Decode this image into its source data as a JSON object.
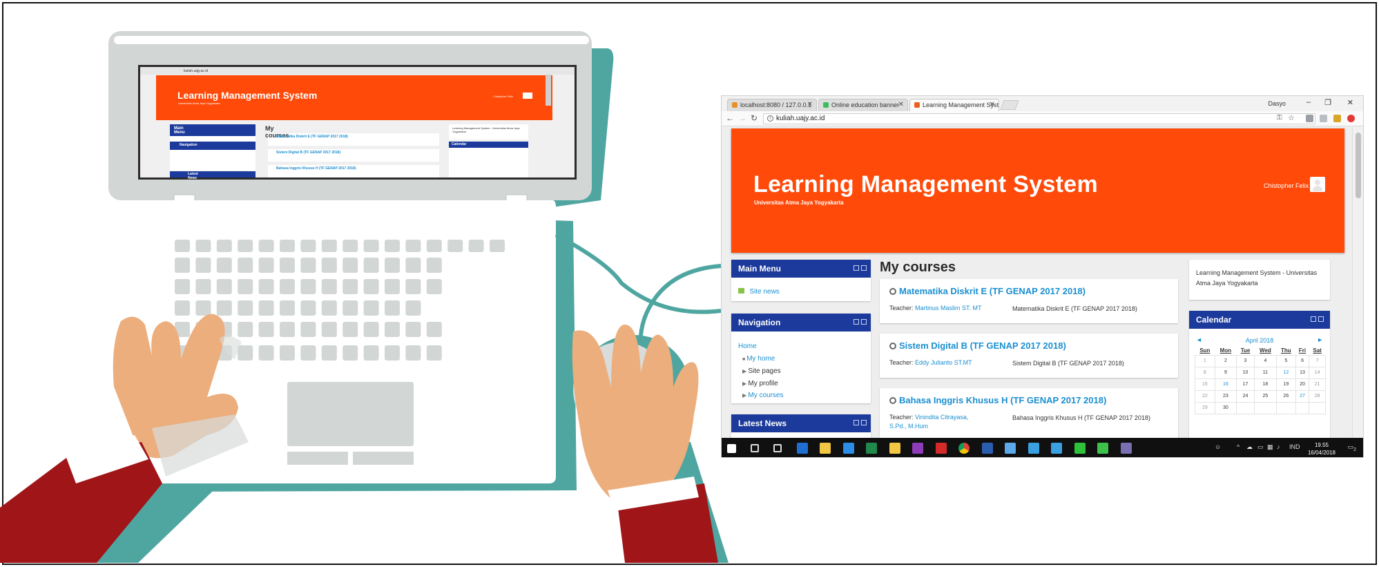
{
  "tabs": [
    {
      "label": "localhost:8080 / 127.0.0.1",
      "icon": "database-icon",
      "color": "#e8902a"
    },
    {
      "label": "Online education banner",
      "icon": "file-icon",
      "color": "#3cbd5b"
    },
    {
      "label": "Learning Management System",
      "icon": "moodle-icon",
      "color": "#e8611a"
    }
  ],
  "window": {
    "user": "Dasyo",
    "minimize": "–",
    "restore": "❐",
    "close": "✕"
  },
  "address": {
    "url": "kuliah.uajy.ac.id"
  },
  "banner": {
    "title": "Learning Management System",
    "subtitle": "Universitas Atma Jaya Yogyakarta",
    "user_name": "Chistopher Felix",
    "color": "#ff4a0a"
  },
  "main_menu": {
    "title": "Main Menu",
    "items": [
      {
        "label": "Site news"
      }
    ]
  },
  "navigation": {
    "title": "Navigation",
    "home": "Home",
    "items": [
      {
        "label": "My home",
        "link": true
      },
      {
        "label": "Site pages",
        "link": false
      },
      {
        "label": "My profile",
        "link": false
      },
      {
        "label": "My courses",
        "link": true
      }
    ]
  },
  "latest_news": {
    "title": "Latest News"
  },
  "my_courses": {
    "heading": "My courses",
    "courses": [
      {
        "title": "Matematika Diskrit E (TF GENAP 2017 2018)",
        "teacher_label": "Teacher:",
        "teacher": "Martinus Maslim ST. MT",
        "summary": "Matematika Diskrit E (TF GENAP 2017 2018)"
      },
      {
        "title": "Sistem Digital B (TF GENAP 2017 2018)",
        "teacher_label": "Teacher:",
        "teacher": "Eddy Julianto ST.MT",
        "summary": "Sistem Digital B (TF GENAP 2017 2018)"
      },
      {
        "title": "Bahasa Inggris Khusus H (TF GENAP 2017 2018)",
        "teacher_label": "Teacher:",
        "teacher": "Vinindita Citrayasa, S.Pd., M.Hum",
        "summary": "Bahasa Inggris Khusus H (TF GENAP 2017 2018)"
      }
    ]
  },
  "about": {
    "text": "Learning Management System - Universitas Atma Jaya Yogyakarta"
  },
  "calendar": {
    "title": "Calendar",
    "month": "April 2018",
    "prev": "◄",
    "next": "►",
    "days": [
      "Sun",
      "Mon",
      "Tue",
      "Wed",
      "Thu",
      "Fri",
      "Sat"
    ],
    "weeks": [
      [
        "1",
        "2",
        "3",
        "4",
        "5",
        "6",
        "7"
      ],
      [
        "8",
        "9",
        "10",
        "11",
        "12",
        "13",
        "14"
      ],
      [
        "15",
        "16",
        "17",
        "18",
        "19",
        "20",
        "21"
      ],
      [
        "22",
        "23",
        "24",
        "25",
        "26",
        "27",
        "28"
      ],
      [
        "29",
        "30",
        "",
        "",
        "",
        "",
        ""
      ]
    ],
    "linked_days": [
      "12",
      "16",
      "27"
    ]
  },
  "taskbar": {
    "lang": "IND",
    "time": "19.55",
    "date": "16/04/2018",
    "notifications": "2",
    "apps": [
      {
        "icon": "windows-start-icon",
        "color": "#ffffff"
      },
      {
        "icon": "search-icon",
        "color": "#dddddd"
      },
      {
        "icon": "task-view-icon",
        "color": "#dddddd"
      },
      {
        "icon": "outlook-icon",
        "color": "#1f6fd1"
      },
      {
        "icon": "file-explorer-icon",
        "color": "#f2c744"
      },
      {
        "icon": "edge-icon",
        "color": "#2d8ce6"
      },
      {
        "icon": "excel-icon",
        "color": "#1f8a4c"
      },
      {
        "icon": "store-icon",
        "color": "#f2c744"
      },
      {
        "icon": "onenote-icon",
        "color": "#8d3cb8"
      },
      {
        "icon": "acrobat-icon",
        "color": "#d42a2a"
      },
      {
        "icon": "chrome-icon",
        "color": "#e7b526"
      },
      {
        "icon": "word-icon",
        "color": "#2a5db0"
      },
      {
        "icon": "dropbox-icon",
        "color": "#5da8e8"
      },
      {
        "icon": "app-icon",
        "color": "#3aa0e0"
      },
      {
        "icon": "app-icon",
        "color": "#3aa0e0"
      },
      {
        "icon": "line-icon",
        "color": "#2ec23a"
      },
      {
        "icon": "app-icon",
        "color": "#3cc24a"
      },
      {
        "icon": "app-icon",
        "color": "#7a6fb0"
      }
    ]
  },
  "laptop": {
    "title": "Learning Management System",
    "subtitle": "Universitas Atma Jaya Yogyakarta",
    "user": "Chistopher Felix",
    "heading": "My courses",
    "url": "kuliah.uajy.ac.id",
    "menu": "Main Menu",
    "nav": "Navigation",
    "news": "Latest News",
    "calendar": "Calendar",
    "course1": "Matematika Diskrit E (TF GENAP 2017 2018)",
    "course2": "Sistem Digital B (TF GENAP 2017 2018)",
    "course3": "Bahasa Inggris Khusus H (TF GENAP 2017 2018)",
    "about": "Learning Management System - Universitas Atma Jaya Yogyakarta"
  }
}
